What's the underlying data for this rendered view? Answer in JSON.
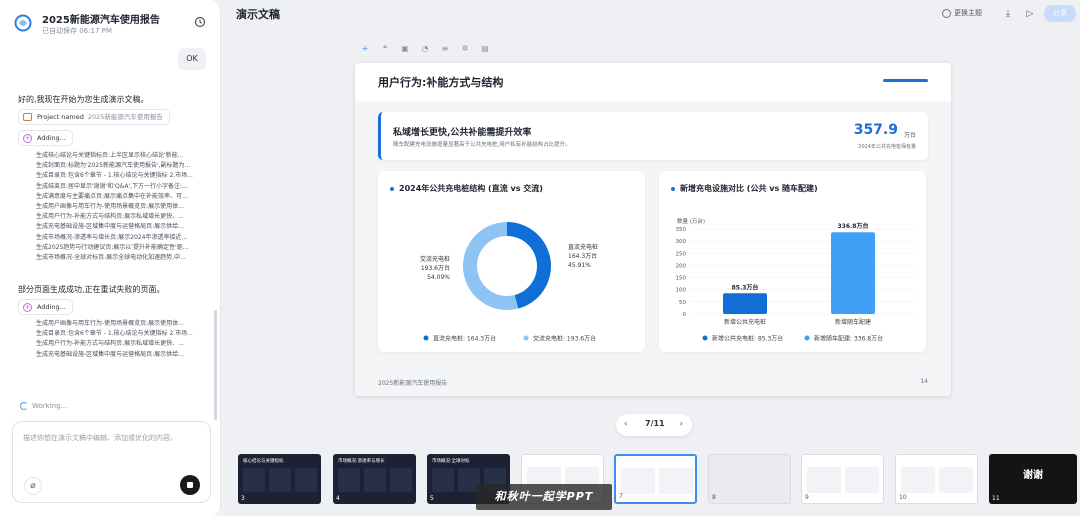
{
  "left_panel": {
    "doc_title": "2025新能源汽车使用报告",
    "saved_status": "已自动保存 06:17 PM",
    "user_message": "OK",
    "assistant_intro": "好的,我现在开始为您生成演示文稿。",
    "project_chip": {
      "label": "Project named",
      "name": "2025新能源汽车使用报告"
    },
    "adding_label": "Adding...",
    "steps_1": [
      "生成核心结论与关键指标页:上半区显示核心结论'新能...",
      "生成封面页:标题为'2025新能源汽车使用报告',副标题为...",
      "生成目录页:包含6个章节 - 1.核心结论与关键指标 2.市场...",
      "生成结束页:居中显示'谢谢'和'Q&A',下方一行小字备注:...",
      "生成满意度与主要痛点页:展示痛点集中在补能效率、可...",
      "生成用户画像与用车行为-使用场景概览页:展示使用体...",
      "生成用户行为-补能方式与结构页:展示私域增长更快、...",
      "生成充电基础设施-区域集中度与运营格局页:展示供给...",
      "生成市场概况-渗透率与增长页:展示2024年渗透率接近...",
      "生成2025趋势与行动建议页:展示以'提升补能确定性'驱...",
      "生成市场概况-全球对标页:展示全球电动化加速趋势,中..."
    ],
    "partial_message": "部分页面生成成功,正在重试失败的页面。",
    "steps_2": [
      "生成用户画像与用车行为-使用场景概览页:展示使用体...",
      "生成目录页:包含6个章节 - 1.核心结论与关键指标 2.市场...",
      "生成用户行为-补能方式与结构页:展示私域增长更快、...",
      "生成充电基础设施-区域集中度与运营格局页:展示供给..."
    ],
    "working_label": "Working...",
    "input_placeholder": "描述你想在演示文稿中编辑、添加或优化的内容。"
  },
  "topbar": {
    "title": "演示文稿",
    "theme_button": "更换主题",
    "share_button": "分享"
  },
  "slide": {
    "title": "用户行为:补能方式与结构",
    "kpi": {
      "headline": "私域增长更快,公共补能需提升效率",
      "subtext": "随车配建充电设施增量显著高于公共充电桩,用户私有补能结构占比提升。",
      "value": "357.9",
      "unit": "万台",
      "caption": "2024年公共充电桩保有量"
    },
    "footer": "2025新能源汽车使用报告",
    "page_number": "14"
  },
  "chart_data": [
    {
      "type": "pie",
      "title": "2024年公共充电桩结构 (直流 vs 交流)",
      "categories": [
        "直流充电桩",
        "交流充电桩"
      ],
      "values": [
        164.3,
        193.6
      ],
      "value_labels": [
        "164.3万台",
        "193.6万台"
      ],
      "percent_labels": [
        "45.91%",
        "54.09%"
      ],
      "donut": true,
      "colors": [
        "#0f6fd6",
        "#8ec4f3"
      ],
      "legend": [
        "直流充电桩: 164.3万台",
        "交流充电桩: 193.6万台"
      ],
      "legend_placement": "bottom"
    },
    {
      "type": "bar",
      "title": "新增充电设施对比 (公共 vs 随车配建)",
      "ylabel": "数量 (万台)",
      "categories": [
        "新增公共充电桩",
        "新增随车配建"
      ],
      "values": [
        85.3,
        336.8
      ],
      "value_labels": [
        "85.3万台",
        "336.8万台"
      ],
      "ylim": [
        0,
        350
      ],
      "yticks": [
        "0",
        "50",
        "100",
        "150",
        "200",
        "250",
        "300",
        "350"
      ],
      "colors": [
        "#0f6fd6",
        "#3fa0f5"
      ],
      "legend": [
        "新增公共充电桩: 85.3万台",
        "新增随车配建: 336.8万台"
      ],
      "legend_placement": "bottom",
      "grid": true
    }
  ],
  "pager": {
    "prev": "‹",
    "current": "7/11",
    "next": "›"
  },
  "thumbnails": [
    {
      "num": "3",
      "label": "核心结论与关键指标"
    },
    {
      "num": "4",
      "label": "市场概况:渗透率与增长"
    },
    {
      "num": "5",
      "label": "市场概况:全球对标"
    },
    {
      "num": "6",
      "label": ""
    },
    {
      "num": "7",
      "label": ""
    },
    {
      "num": "8",
      "label": ""
    },
    {
      "num": "9",
      "label": ""
    },
    {
      "num": "10",
      "label": ""
    },
    {
      "num": "11",
      "label": "谢谢"
    }
  ],
  "watermark": "和秋叶一起学PPT"
}
